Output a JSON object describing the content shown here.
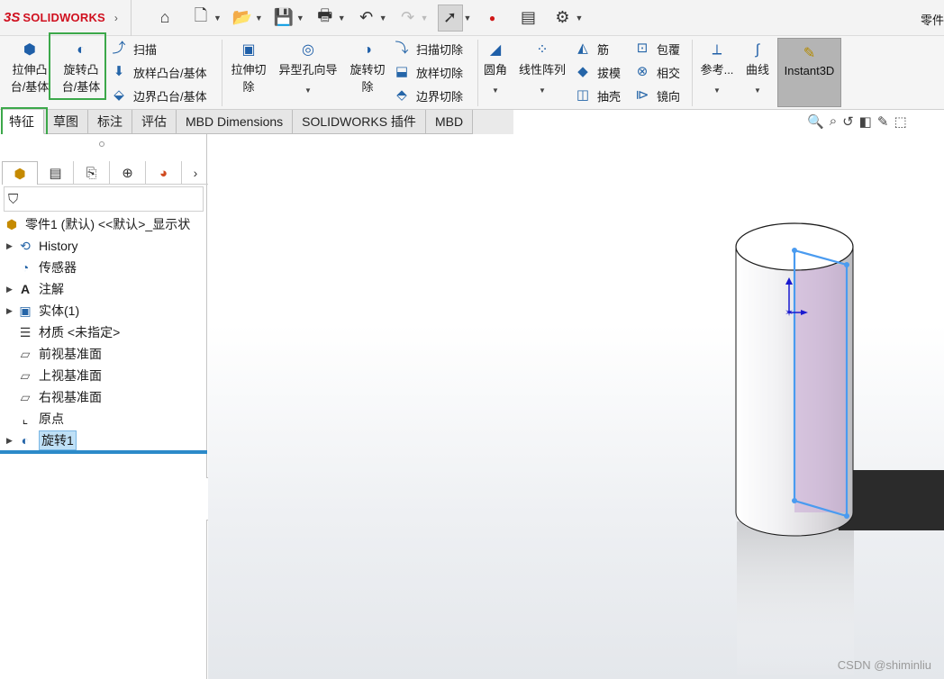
{
  "app": {
    "logo_mark": "3S",
    "logo_text": "SOLIDWORKS",
    "document_title_partial": "零件"
  },
  "quick_access": [
    {
      "icon": "home-icon",
      "glyph": "⌂"
    },
    {
      "icon": "new-document-icon",
      "glyph": "🗋"
    },
    {
      "icon": "open-folder-icon",
      "glyph": "📂"
    },
    {
      "icon": "save-icon",
      "glyph": "💾"
    },
    {
      "icon": "print-icon",
      "glyph": "🖶"
    },
    {
      "icon": "undo-icon",
      "glyph": "↶"
    },
    {
      "icon": "redo-icon",
      "glyph": "↷"
    },
    {
      "icon": "select-cursor-icon",
      "glyph": "➚"
    },
    {
      "icon": "rebuild-traffic-light-icon",
      "glyph": "●"
    },
    {
      "icon": "file-properties-icon",
      "glyph": "▤"
    },
    {
      "icon": "options-gear-icon",
      "glyph": "⚙"
    }
  ],
  "ribbon": {
    "extrude_boss": "拉伸凸台/基体",
    "revolve_boss": "旋转凸台/基体",
    "sweep": "扫描",
    "loft_boss": "放样凸台/基体",
    "boundary_boss": "边界凸台/基体",
    "extrude_cut": "拉伸切除",
    "hole_wizard": "异型孔向导",
    "revolve_cut": "旋转切除",
    "sweep_cut": "扫描切除",
    "loft_cut": "放样切除",
    "boundary_cut": "边界切除",
    "fillet": "圆角",
    "linear_pattern": "线性阵列",
    "rib": "筋",
    "draft": "拔模",
    "shell": "抽壳",
    "wrap": "包覆",
    "intersect": "相交",
    "mirror": "镜向",
    "reference": "参考...",
    "curves": "曲线",
    "instant3d": "Instant3D"
  },
  "tabs": [
    "特征",
    "草图",
    "标注",
    "评估",
    "MBD Dimensions",
    "SOLIDWORKS 插件",
    "MBD"
  ],
  "tree": {
    "root": "零件1 (默认) <<默认>_显示状",
    "items": [
      "History",
      "传感器",
      "注解",
      "实体(1)",
      "材质 <未指定>",
      "前视基准面",
      "上视基准面",
      "右视基准面",
      "原点",
      "旋转1"
    ]
  },
  "watermark": "CSDN @shiminliu",
  "colors": {
    "logo_red": "#d0101f",
    "highlight_green": "#3ca84a",
    "selection_blue": "#4a9bf0",
    "rollback_blue": "#2c8ac9"
  }
}
